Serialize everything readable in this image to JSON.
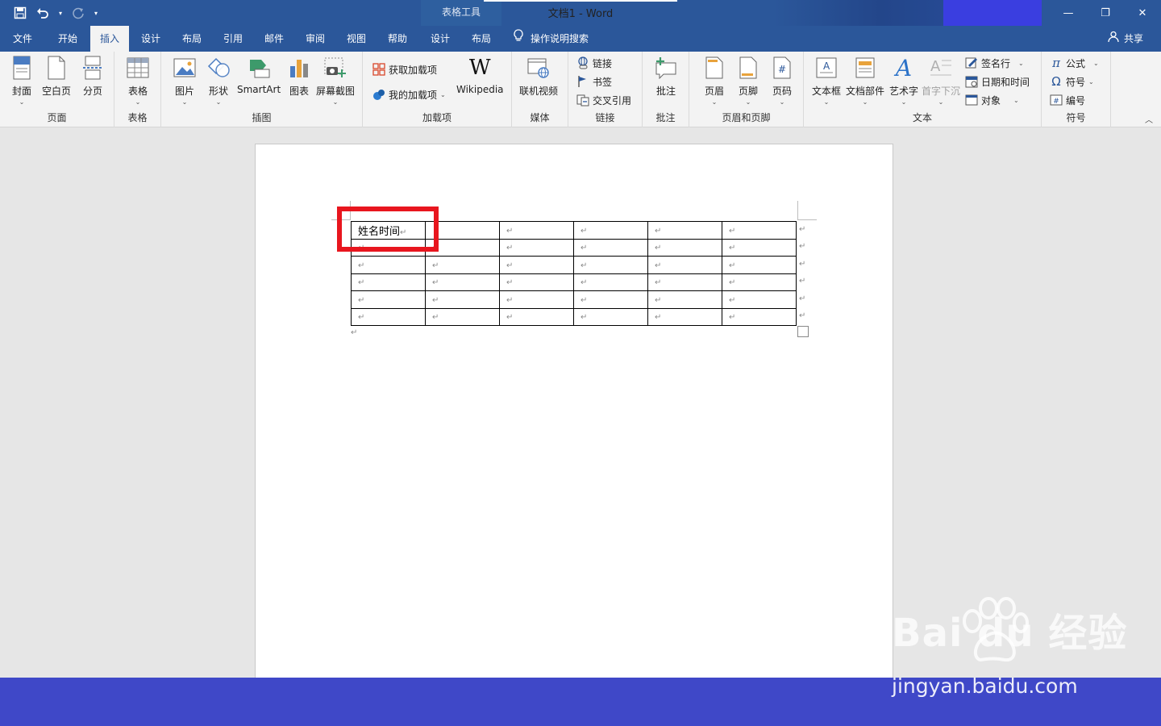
{
  "window": {
    "doc_title": "文档1  -  Word",
    "context_label": "表格工具",
    "controls": {
      "minimize": "—",
      "restore": "❐",
      "close": "✕"
    }
  },
  "tabs": [
    "文件",
    "开始",
    "插入",
    "设计",
    "布局",
    "引用",
    "邮件",
    "审阅",
    "视图",
    "帮助",
    "设计",
    "布局"
  ],
  "active_tab": "插入",
  "tellme": "操作说明搜索",
  "share": "共享",
  "ribbon": {
    "pages": {
      "label": "页面",
      "cover": "封面",
      "blank": "空白页",
      "break": "分页"
    },
    "tables": {
      "label": "表格",
      "table": "表格"
    },
    "illustrations": {
      "label": "插图",
      "picture": "图片",
      "shapes": "形状",
      "smartart": "SmartArt",
      "chart": "图表",
      "screenshot": "屏幕截图"
    },
    "addins": {
      "label": "加载项",
      "get": "获取加载项",
      "my": "我的加载项",
      "wikipedia": "Wikipedia"
    },
    "media": {
      "label": "媒体",
      "video": "联机视频"
    },
    "links": {
      "label": "链接",
      "link": "链接",
      "bookmark": "书签",
      "crossref": "交叉引用"
    },
    "comments": {
      "label": "批注",
      "comment": "批注"
    },
    "headerfooter": {
      "label": "页眉和页脚",
      "header": "页眉",
      "footer": "页脚",
      "pagenum": "页码"
    },
    "text": {
      "label": "文本",
      "textbox": "文本框",
      "quickparts": "文档部件",
      "wordart": "艺术字",
      "dropcap": "首字下沉",
      "signature": "签名行",
      "datetime": "日期和时间",
      "object": "对象"
    },
    "symbols": {
      "label": "符号",
      "equation": "公式",
      "symbol": "符号",
      "number": "编号"
    }
  },
  "document": {
    "table_first_cell": "姓名时间",
    "para_mark": "↵"
  },
  "watermark": {
    "logo": "Bai  du 经验",
    "url": "jingyan.baidu.com"
  }
}
